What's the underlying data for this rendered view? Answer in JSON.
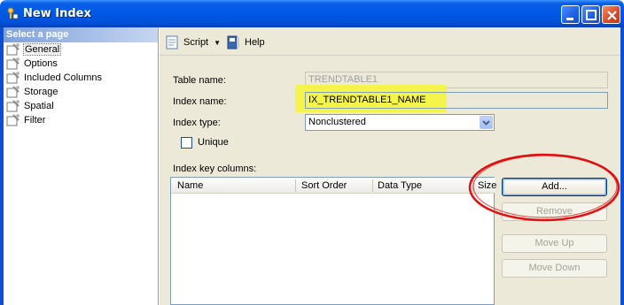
{
  "window": {
    "title": "New Index"
  },
  "left_pane": {
    "header": "Select a page",
    "items": [
      {
        "label": "General",
        "selected": true
      },
      {
        "label": "Options"
      },
      {
        "label": "Included Columns"
      },
      {
        "label": "Storage"
      },
      {
        "label": "Spatial"
      },
      {
        "label": "Filter"
      }
    ]
  },
  "toolbar": {
    "script_label": "Script",
    "help_label": "Help"
  },
  "form": {
    "table_name_label": "Table name:",
    "table_name_value": "TRENDTABLE1",
    "index_name_label": "Index name:",
    "index_name_value": "IX_TRENDTABLE1_NAME",
    "index_type_label": "Index type:",
    "index_type_value": "Nonclustered",
    "unique_label": "Unique",
    "key_columns_label": "Index key columns:"
  },
  "grid": {
    "columns": [
      "Name",
      "Sort Order",
      "Data Type",
      "Size"
    ]
  },
  "buttons": {
    "add": "Add...",
    "remove": "Remove",
    "move_up": "Move Up",
    "move_down": "Move Down"
  },
  "colors": {
    "titlebar": "#0058e6",
    "highlight": "#f5f53c",
    "annotation": "#e01010"
  }
}
